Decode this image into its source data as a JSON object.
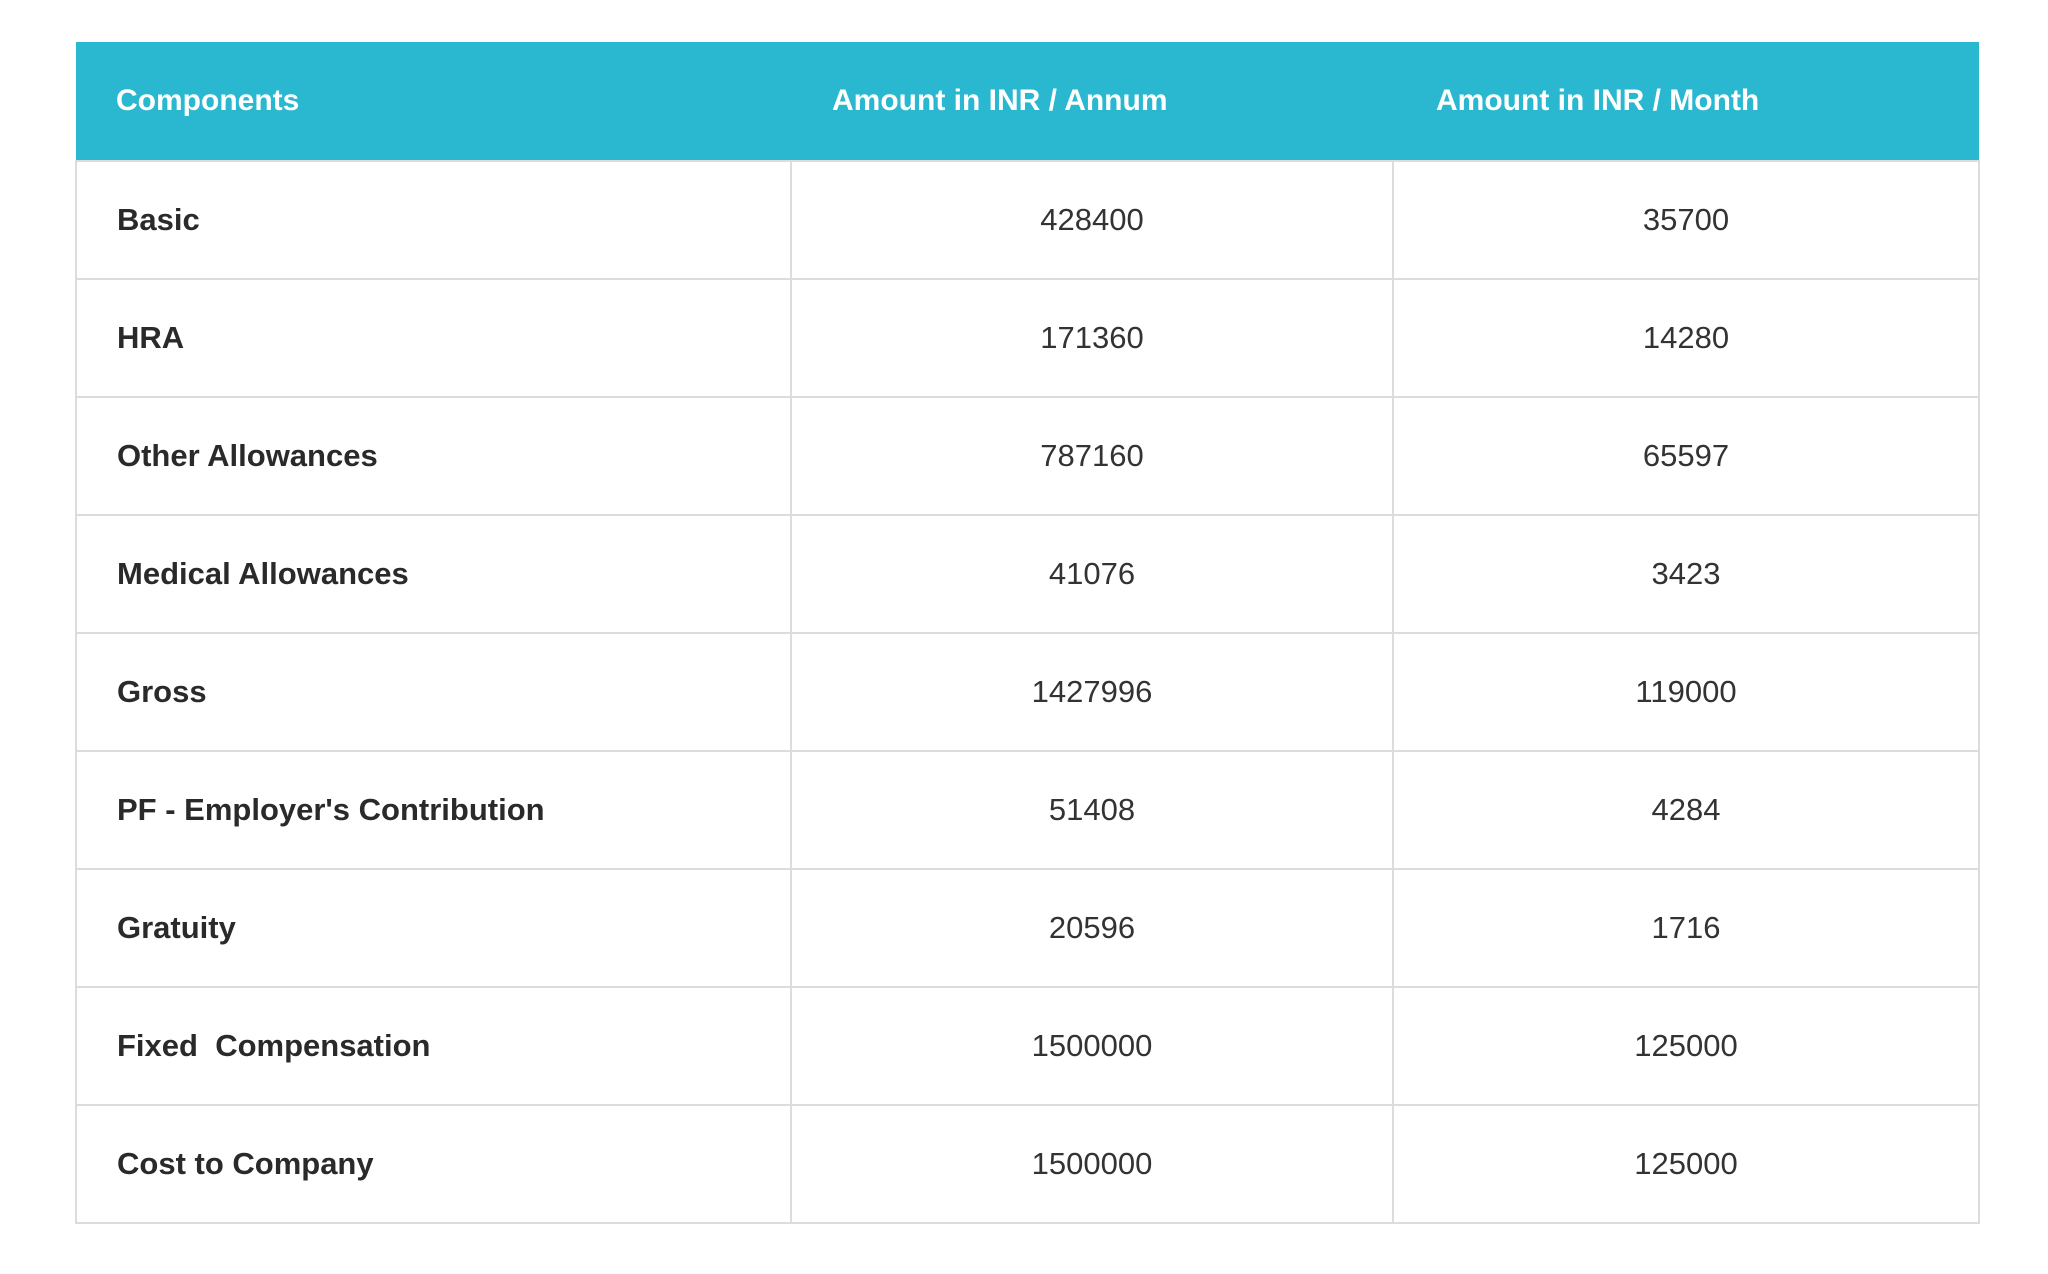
{
  "table": {
    "headers": {
      "components": "Components",
      "annum": "Amount in INR / Annum",
      "month": "Amount in INR / Month"
    },
    "rows": [
      {
        "component": "Basic",
        "annum": "428400",
        "month": "35700"
      },
      {
        "component": "HRA",
        "annum": "171360",
        "month": "14280"
      },
      {
        "component": "Other Allowances",
        "annum": "787160",
        "month": "65597"
      },
      {
        "component": "Medical Allowances",
        "annum": "41076",
        "month": "3423"
      },
      {
        "component": "Gross",
        "annum": "1427996",
        "month": "119000"
      },
      {
        "component": "PF - Employer's Contribution",
        "annum": "51408",
        "month": "4284"
      },
      {
        "component": "Gratuity",
        "annum": "20596",
        "month": "1716"
      },
      {
        "component": "Fixed  Compensation",
        "annum": "1500000",
        "month": "125000"
      },
      {
        "component": "Cost to Company",
        "annum": "1500000",
        "month": "125000"
      }
    ]
  },
  "colors": {
    "header_background": "#29b8d0",
    "header_text": "#ffffff",
    "grid_line": "#dcdcdc"
  }
}
